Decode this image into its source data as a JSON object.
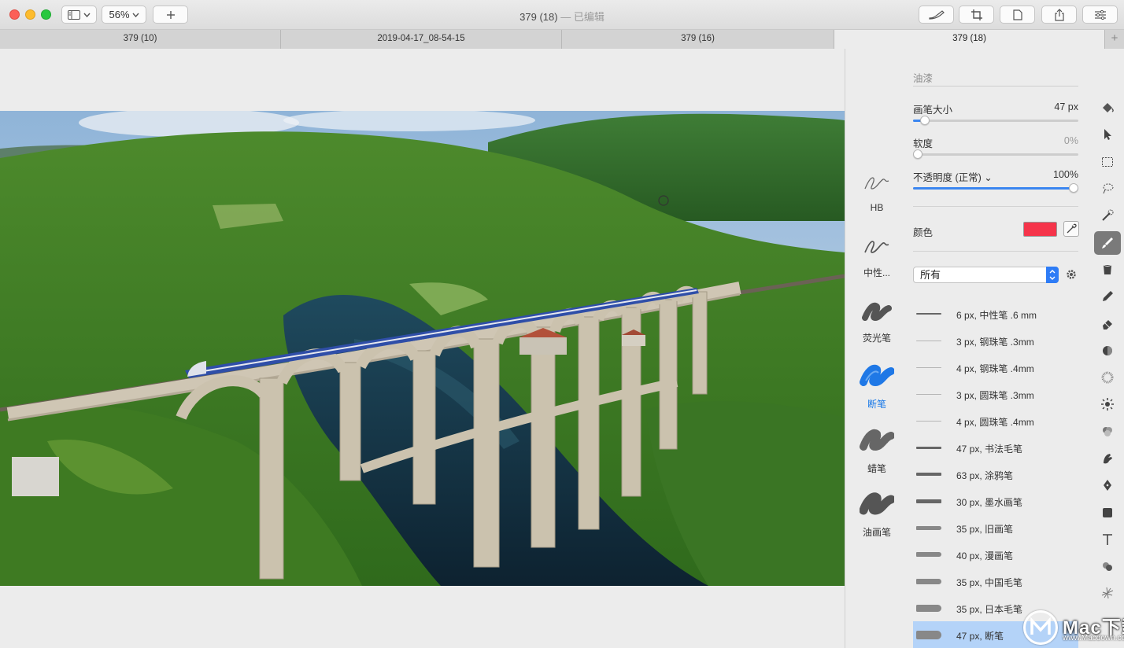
{
  "window": {
    "title": "379 (18)",
    "subtitle": "— 已编辑",
    "zoom": "56%"
  },
  "tabs": [
    {
      "label": "379 (10)",
      "active": false
    },
    {
      "label": "2019-04-17_08-54-15",
      "active": false
    },
    {
      "label": "379 (16)",
      "active": false
    },
    {
      "label": "379 (18)",
      "active": true
    }
  ],
  "panel": {
    "section_title": "油漆",
    "brush_size": {
      "label": "画笔大小",
      "value": "47 px",
      "fraction": 0.07
    },
    "softness": {
      "label": "软度",
      "value": "0%",
      "fraction": 0.0
    },
    "opacity": {
      "label": "不透明度 (正常) ⌄",
      "value": "100%",
      "fraction": 1.0
    },
    "color": {
      "label": "颜色",
      "hex": "#f5344a"
    },
    "category": {
      "selected": "所有"
    }
  },
  "presets": [
    {
      "label": "HB",
      "selected": false
    },
    {
      "label": "中性...",
      "selected": false
    },
    {
      "label": "荧光笔",
      "selected": false
    },
    {
      "label": "断笔",
      "selected": true
    },
    {
      "label": "蜡笔",
      "selected": false
    },
    {
      "label": "油画笔",
      "selected": false
    }
  ],
  "brushes": [
    {
      "name": "6 px, 中性笔 .6 mm",
      "weight": 2,
      "selected": false
    },
    {
      "name": "3 px, 钢珠笔 .3mm",
      "weight": 1,
      "selected": false
    },
    {
      "name": "4 px, 钢珠笔 .4mm",
      "weight": 1,
      "selected": false
    },
    {
      "name": "3 px, 圆珠笔 .3mm",
      "weight": 1,
      "selected": false
    },
    {
      "name": "4 px, 圆珠笔 .4mm",
      "weight": 1,
      "selected": false
    },
    {
      "name": "47 px, 书法毛笔",
      "weight": 3,
      "selected": false
    },
    {
      "name": "63 px, 涂鸦笔",
      "weight": 4,
      "selected": false
    },
    {
      "name": "30 px, 墨水画笔",
      "weight": 5,
      "selected": false
    },
    {
      "name": "35 px, 旧画笔",
      "weight": 6,
      "selected": false
    },
    {
      "name": "40 px, 漫画笔",
      "weight": 7,
      "selected": false
    },
    {
      "name": "35 px, 中国毛笔",
      "weight": 8,
      "selected": false
    },
    {
      "name": "35 px, 日本毛笔",
      "weight": 10,
      "selected": false
    },
    {
      "name": "47 px, 断笔",
      "weight": 12,
      "selected": true
    }
  ],
  "tools": [
    "paint-bucket-icon",
    "pointer-icon",
    "rect-select-icon",
    "lasso-icon",
    "magic-select-icon",
    "brush-icon",
    "fill-icon",
    "pencil-icon",
    "eraser-icon",
    "burn-icon",
    "blur-icon",
    "sharpen-icon",
    "color-icon",
    "smudge-icon",
    "pen-icon",
    "shape-icon",
    "text-icon",
    "clone-icon",
    "effects-icon"
  ],
  "watermark": {
    "text": "Mac下载",
    "url": "www.Macdown.com"
  }
}
